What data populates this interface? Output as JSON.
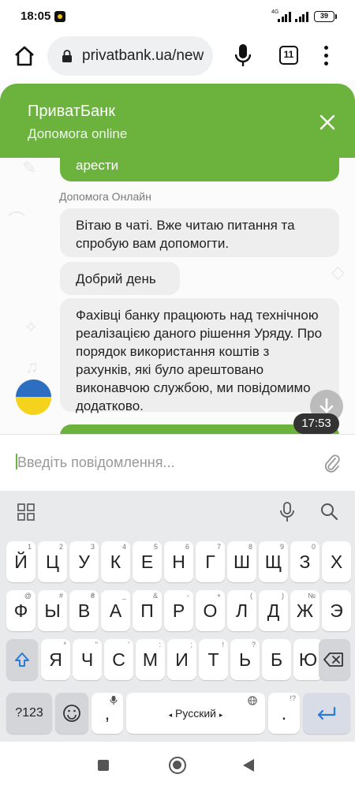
{
  "status_bar": {
    "time": "18:05",
    "network": "4G",
    "battery": "39"
  },
  "browser": {
    "url": "privatbank.ua/new",
    "tab_count": "11"
  },
  "chat": {
    "header": {
      "title": "ПриватБанк",
      "subtitle": "Допомога online"
    },
    "messages": [
      {
        "side": "out",
        "text": "арести"
      },
      {
        "side": "in",
        "text": "Вітаю в чаті. Вже читаю питання та спробую вам допомогти."
      },
      {
        "side": "in",
        "text": "Добрий день"
      },
      {
        "side": "in",
        "text": "Фахівці банку працюють над технічною реалізацією даного рішення Уряду. Про порядок використання коштів з рахунків, які було арештовано виконавчою службою, ми повідомимо додатково."
      }
    ],
    "sender_name": "Допомога Онлайн",
    "timestamp": "17:53",
    "input_placeholder": "Введіть повідомлення..."
  },
  "keyboard": {
    "row1": [
      {
        "k": "Й",
        "h": "1"
      },
      {
        "k": "Ц",
        "h": "2"
      },
      {
        "k": "У",
        "h": "3"
      },
      {
        "k": "К",
        "h": "4"
      },
      {
        "k": "Е",
        "h": "5"
      },
      {
        "k": "Н",
        "h": "6"
      },
      {
        "k": "Г",
        "h": "7"
      },
      {
        "k": "Ш",
        "h": "8"
      },
      {
        "k": "Щ",
        "h": "9"
      },
      {
        "k": "З",
        "h": "0"
      },
      {
        "k": "Х",
        "h": ""
      }
    ],
    "row2": [
      {
        "k": "Ф",
        "h": "@"
      },
      {
        "k": "Ы",
        "h": "#"
      },
      {
        "k": "В",
        "h": "₴"
      },
      {
        "k": "А",
        "h": "_"
      },
      {
        "k": "П",
        "h": "&"
      },
      {
        "k": "Р",
        "h": "-"
      },
      {
        "k": "О",
        "h": "+"
      },
      {
        "k": "Л",
        "h": "("
      },
      {
        "k": "Д",
        "h": ")"
      },
      {
        "k": "Ж",
        "h": "№"
      },
      {
        "k": "Э",
        "h": ""
      }
    ],
    "row3": [
      {
        "k": "Я",
        "h": "*"
      },
      {
        "k": "Ч",
        "h": "\""
      },
      {
        "k": "С",
        "h": "'"
      },
      {
        "k": "М",
        "h": ":"
      },
      {
        "k": "И",
        "h": ";"
      },
      {
        "k": "Т",
        "h": "!"
      },
      {
        "k": "Ь",
        "h": "?"
      },
      {
        "k": "Б",
        "h": ""
      },
      {
        "k": "Ю",
        "h": ""
      }
    ],
    "symbols_key": "?123",
    "comma_key": ",",
    "space_label": "Русский",
    "period_key": ".",
    "period_hint": "!?"
  },
  "colors": {
    "brand_green": "#6cb33e",
    "bubble_gray": "#eeeeee",
    "keyboard_bg": "#e9eaec"
  },
  "icons": {
    "home": "home-icon",
    "lock": "lock-icon",
    "mic": "mic-icon",
    "menu": "more-vert-icon",
    "close": "close-icon",
    "attach": "paperclip-icon",
    "scroll_down": "arrow-down-icon",
    "shift": "shift-icon",
    "backspace": "backspace-icon",
    "emoji": "emoji-icon",
    "enter": "enter-icon"
  }
}
